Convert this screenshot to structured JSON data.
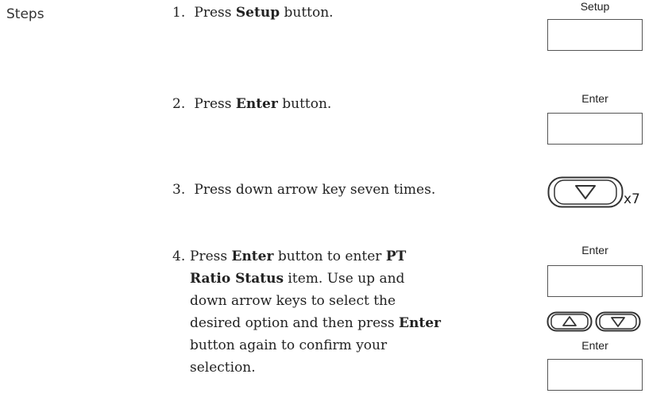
{
  "section_label": "Steps",
  "steps": [
    {
      "num": "1.",
      "pre": "Press ",
      "bold": "Setup",
      "post": " button."
    },
    {
      "num": "2.",
      "pre": "Press ",
      "bold": "Enter",
      "post": " button."
    },
    {
      "num": "3.",
      "text": "Press down arrow key seven times."
    },
    {
      "num": "4.",
      "l1_pre": "Press ",
      "l1_bold1": "Enter",
      "l1_mid": " button to enter ",
      "l1_bold2": "PT",
      "l2_bold": "Ratio Status",
      "l2_post": " item. Use up and",
      "l3": "down arrow keys to select the",
      "l4_pre": "desired option and then press ",
      "l4_bold": "Enter",
      "l5": "button again to confirm your",
      "l6": "selection."
    }
  ],
  "buttons": {
    "setup": "Setup",
    "enter1": "Enter",
    "enter2": "Enter",
    "enter3": "Enter"
  },
  "repeat_label": "x7",
  "icons": {
    "down_arrow": "down-arrow-key-icon",
    "up_arrow": "up-arrow-key-icon"
  }
}
